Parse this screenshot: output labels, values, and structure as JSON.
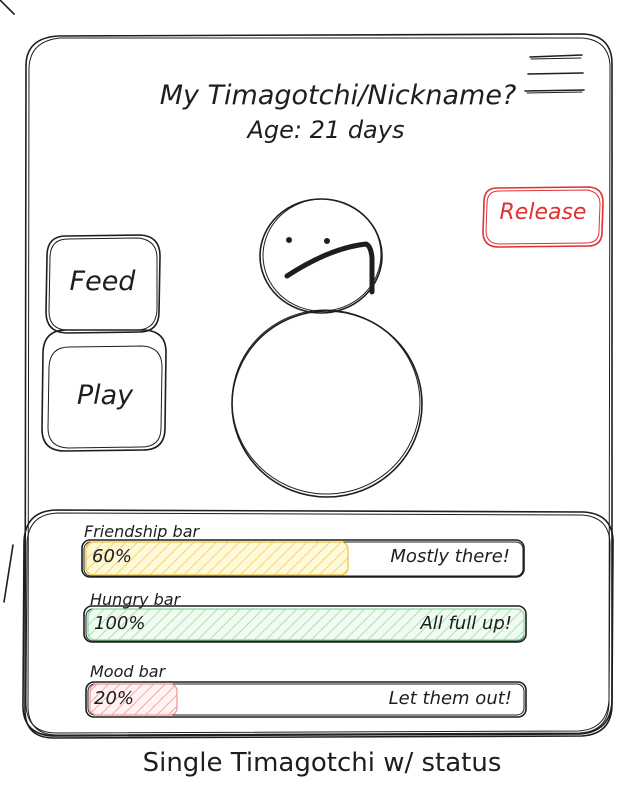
{
  "header": {
    "title": "My Timagotchi/Nickname?",
    "age": "Age: 21 days",
    "menu_icon": "hamburger-menu-icon"
  },
  "actions": {
    "feed_label": "Feed",
    "play_label": "Play",
    "release_label": "Release"
  },
  "pet": {
    "icon": "snowman-pet-sad-face"
  },
  "status_bars": [
    {
      "name": "Friendship bar",
      "percent_label": "60%",
      "level": 0.6,
      "status": "Mostly there!",
      "fill_color": "#ffec99"
    },
    {
      "name": "Hungry bar",
      "percent_label": "100%",
      "level": 1.0,
      "status": "All full up!",
      "fill_color": "#b2f2bb"
    },
    {
      "name": "Mood bar",
      "percent_label": "20%",
      "level": 0.2,
      "status": "Let them out!",
      "fill_color": "#ffc9c9"
    }
  ],
  "caption": "Single Timagotchi w/ status",
  "colors": {
    "stroke": "#1e1e1e",
    "release": "#e03131"
  }
}
